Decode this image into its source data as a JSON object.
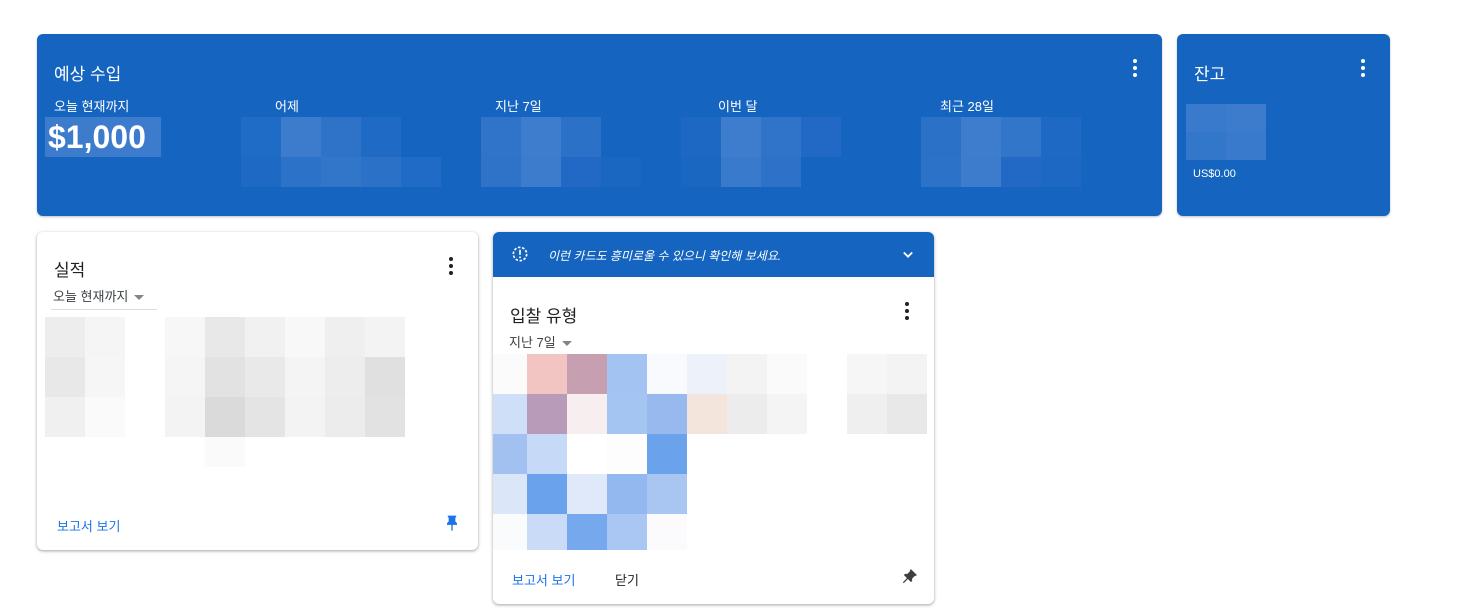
{
  "earnings": {
    "title": "예상 수입",
    "metrics": [
      {
        "label": "오늘 현재까지",
        "value": "$1,000"
      },
      {
        "label": "어제"
      },
      {
        "label": "지난 7일"
      },
      {
        "label": "이번 달"
      },
      {
        "label": "최근 28일"
      }
    ]
  },
  "balance": {
    "title": "잔고",
    "amount": "US$0.00"
  },
  "performance": {
    "title": "실적",
    "range": "오늘 현재까지",
    "report_link": "보고서 보기"
  },
  "bid_types": {
    "banner": "이런 카드도 흥미로울 수 있으니 확인해 보세요.",
    "title": "입찰 유형",
    "range": "지난 7일",
    "report_link": "보고서 보기",
    "close": "닫기"
  },
  "colors": {
    "brand_blue": "#1565c0",
    "link_blue": "#1a73e8"
  },
  "icons": [
    "more-vert-icon",
    "chevron-down-icon",
    "pin-icon",
    "lightbulb-icon"
  ]
}
